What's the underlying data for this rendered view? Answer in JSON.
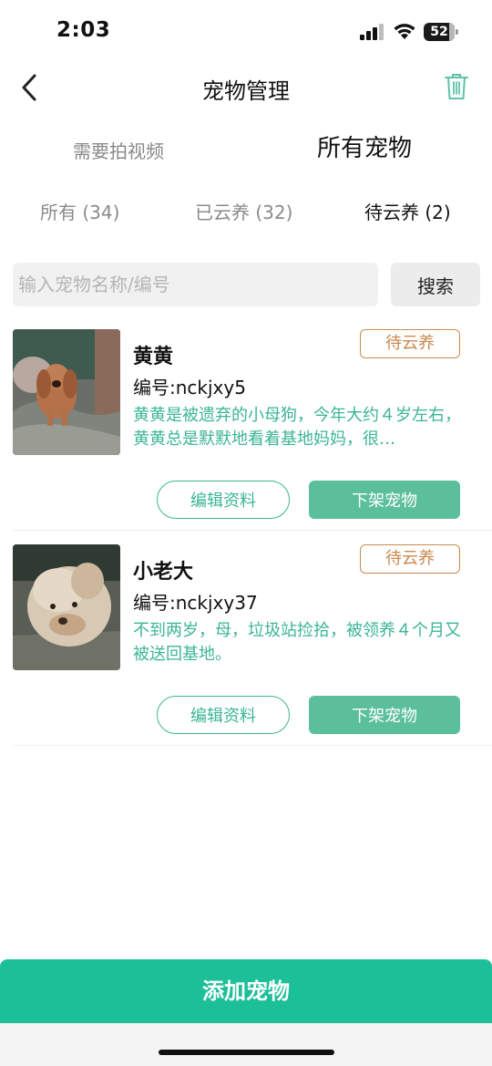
{
  "status_bar": {
    "time": "2:03",
    "battery": "52"
  },
  "nav": {
    "title": "宠物管理",
    "back_icon": "chevron-left-icon",
    "trash_icon": "trash-icon"
  },
  "tabs": [
    {
      "label": "需要拍视频",
      "active": false
    },
    {
      "label": "所有宠物",
      "active": true
    }
  ],
  "filters": [
    {
      "label": "所有 (34)",
      "active": false
    },
    {
      "label": "已云养 (32)",
      "active": false
    },
    {
      "label": "待云养 (2)",
      "active": true
    }
  ],
  "search": {
    "placeholder": "输入宠物名称/编号",
    "value": "",
    "button_label": "搜索"
  },
  "pets": [
    {
      "name": "黄黄",
      "code": "编号:nckjxy5",
      "description": "黄黄是被遗弃的小母狗，今年大约４岁左右，黄黄总是默默地看着基地妈妈，很…",
      "status": "待云养",
      "edit_label": "编辑资料",
      "offline_label": "下架宠物"
    },
    {
      "name": "小老大",
      "code": "编号:nckjxy37",
      "description": "不到两岁，母，垃圾站捡拾，被领养４个月又被送回基地。",
      "status": "待云养",
      "edit_label": "编辑资料",
      "offline_label": "下架宠物"
    }
  ],
  "add_button_label": "添加宠物",
  "colors": {
    "accent": "#1dbf99",
    "button_green": "#5cbf9c",
    "desc_green": "#3bb596",
    "badge_orange": "#c9894d"
  }
}
